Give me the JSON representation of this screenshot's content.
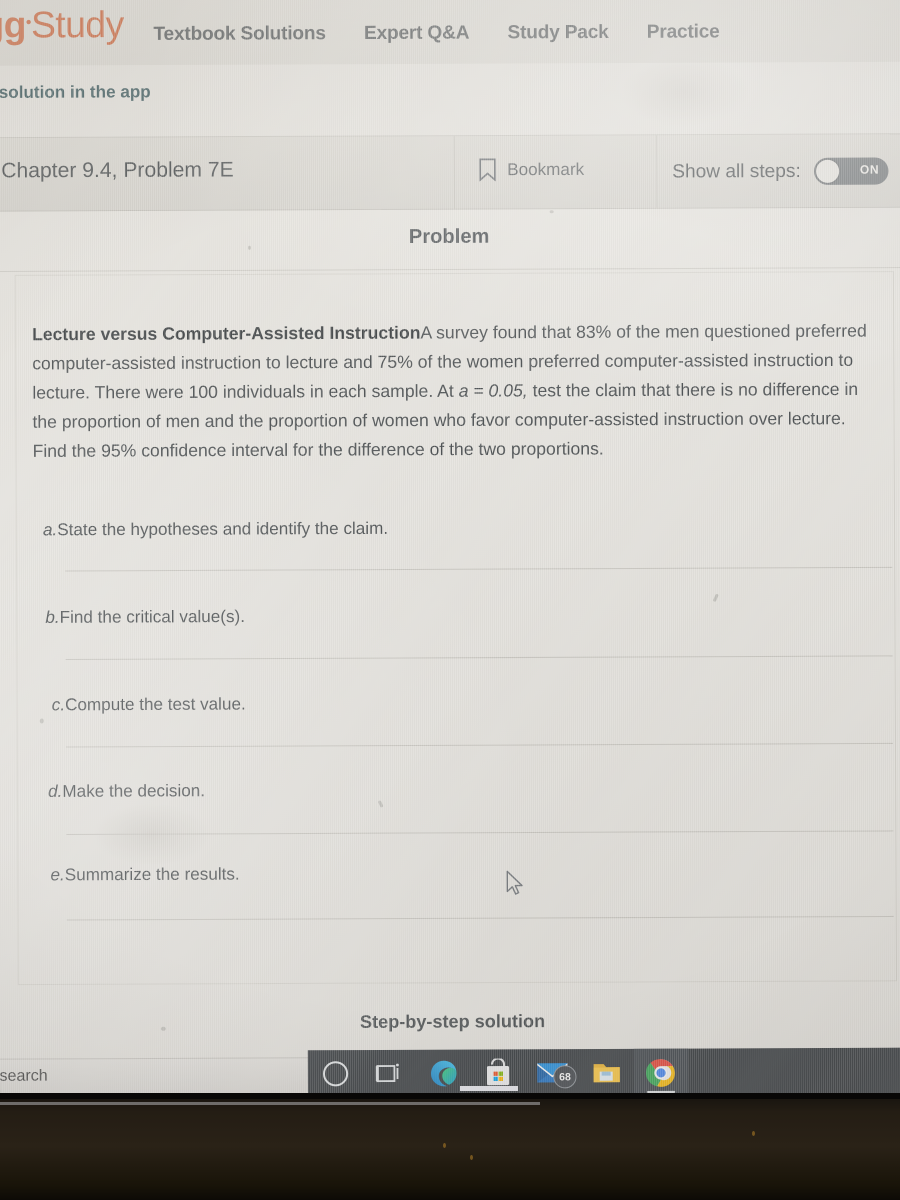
{
  "site": {
    "logo_text": "gg",
    "logo_word": "Study",
    "logo_color": "#cf6034",
    "nav_items": [
      {
        "label": "Textbook Solutions"
      },
      {
        "label": "Expert Q&A"
      },
      {
        "label": "Study Pack"
      },
      {
        "label": "Practice"
      }
    ],
    "app_promo": "is solution in the app"
  },
  "solution_header": {
    "chapter_title": "Chapter 9.4, Problem 7E",
    "bookmark_label": "Bookmark",
    "bookmark_icon": "bookmark-icon",
    "show_all_steps_label": "Show all steps:",
    "toggle_state": "ON"
  },
  "problem": {
    "section_heading": "Problem",
    "title": "Lecture versus Computer-Assisted Instruction",
    "body": "A survey found that 83% of the men questioned preferred computer-assisted instruction to lecture and 75% of the women preferred computer-assisted instruction to lecture. There were 100 individuals in each sample. At ",
    "alpha_expr": "a = 0.05,",
    "body_2": " test the claim that there is no difference in the proportion of men and the proportion of women who favor computer-assisted instruction over lecture. Find the 95% confidence interval for the difference of the two proportions.",
    "parts": [
      {
        "letter": "a.",
        "text": "State the hypotheses and identify the claim."
      },
      {
        "letter": "b.",
        "text": "Find the critical value(s)."
      },
      {
        "letter": "c.",
        "text": "Compute the test value."
      },
      {
        "letter": "d.",
        "text": "Make the decision."
      },
      {
        "letter": "e.",
        "text": "Summarize the results."
      }
    ]
  },
  "step_by_step": {
    "heading": "Step-by-step solution"
  },
  "taskbar": {
    "search_placeholder": "o search",
    "items": [
      {
        "name": "cortana-icon",
        "label": "Cortana",
        "badge": null,
        "active": false,
        "underline": false
      },
      {
        "name": "task-view-icon",
        "label": "Task View",
        "badge": null,
        "active": false,
        "underline": false
      },
      {
        "name": "microsoft-edge-icon",
        "label": "Microsoft Edge",
        "badge": null,
        "active": false,
        "underline": true
      },
      {
        "name": "microsoft-store-icon",
        "label": "Microsoft Store",
        "badge": null,
        "active": false,
        "underline": false
      },
      {
        "name": "mail-icon",
        "label": "Mail",
        "badge": "68",
        "active": false,
        "underline": false
      },
      {
        "name": "file-explorer-icon",
        "label": "File Explorer",
        "badge": null,
        "active": false,
        "underline": false
      },
      {
        "name": "google-chrome-icon",
        "label": "Google Chrome",
        "badge": null,
        "active": true,
        "underline": true
      }
    ]
  }
}
